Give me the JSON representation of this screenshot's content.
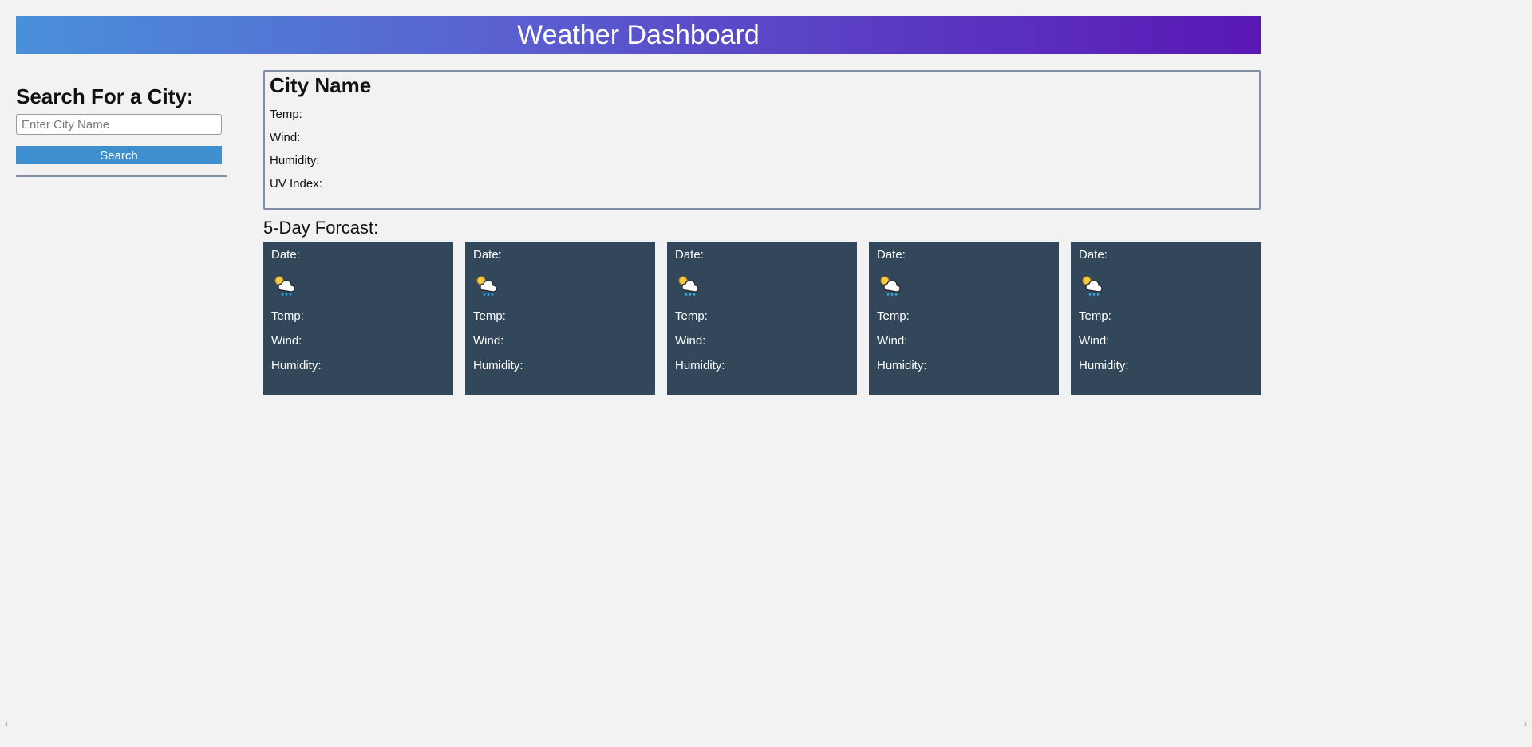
{
  "header": {
    "title": "Weather Dashboard"
  },
  "search": {
    "heading": "Search For a City:",
    "placeholder": "Enter City Name",
    "button_label": "Search"
  },
  "current": {
    "city_label": "City Name",
    "temp_label": "Temp:",
    "wind_label": "Wind:",
    "humidity_label": "Humidity:",
    "uv_label": "UV Index:"
  },
  "forecast": {
    "heading": "5-Day Forcast:",
    "cards": [
      {
        "date_label": "Date:",
        "icon_name": "sun-cloud-rain-icon",
        "temp_label": "Temp:",
        "wind_label": "Wind:",
        "humidity_label": "Humidity:"
      },
      {
        "date_label": "Date:",
        "icon_name": "sun-cloud-rain-icon",
        "temp_label": "Temp:",
        "wind_label": "Wind:",
        "humidity_label": "Humidity:"
      },
      {
        "date_label": "Date:",
        "icon_name": "sun-cloud-rain-icon",
        "temp_label": "Temp:",
        "wind_label": "Wind:",
        "humidity_label": "Humidity:"
      },
      {
        "date_label": "Date:",
        "icon_name": "sun-cloud-rain-icon",
        "temp_label": "Temp:",
        "wind_label": "Wind:",
        "humidity_label": "Humidity:"
      },
      {
        "date_label": "Date:",
        "icon_name": "sun-cloud-rain-icon",
        "temp_label": "Temp:",
        "wind_label": "Wind:",
        "humidity_label": "Humidity:"
      }
    ]
  }
}
